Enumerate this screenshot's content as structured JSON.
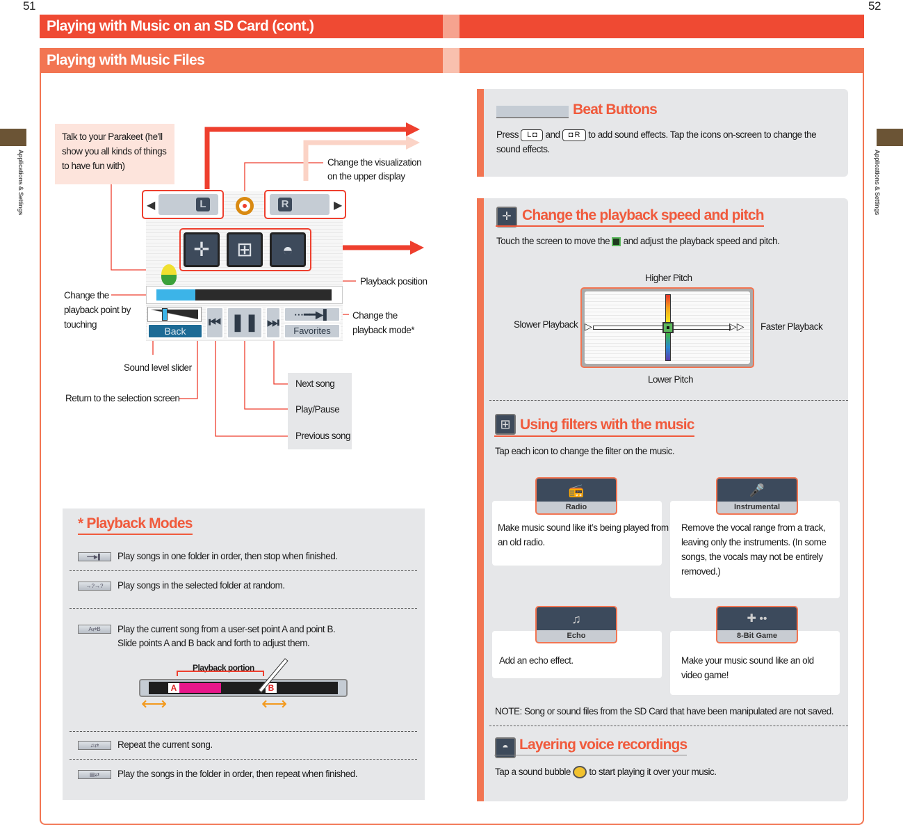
{
  "page_numbers": {
    "left": "51",
    "right": "52"
  },
  "header": {
    "title": "Playing with Music on an SD Card (cont.)",
    "subtitle": "Playing with Music Files"
  },
  "side_tab": {
    "label": "Applications & Settings",
    "color": "#6b5435"
  },
  "colors": {
    "accent": "#ef4a33",
    "accent_light": "#f27552",
    "panel": "#e6e7e9"
  },
  "diagram": {
    "callouts": {
      "parakeet": "Talk to your Parakeet (he'll show you all kinds of things to have fun with)",
      "visualization": "Change the visualization on the upper display",
      "playback_position": "Playback position",
      "playback_point": "Change the playback point by touching",
      "playback_mode": "Change the playback mode*",
      "sound_level": "Sound level slider",
      "return": "Return to the selection screen",
      "next": "Next song",
      "play_pause": "Play/Pause",
      "previous": "Previous song"
    },
    "screen": {
      "back_label": "Back",
      "favorites_label": "Favorites",
      "left_key": "L",
      "right_key": "R",
      "playback_progress": 0.25,
      "volume_level": 0.3
    }
  },
  "playback_modes": {
    "title": "* Playback Modes",
    "items": [
      {
        "icon": "arrow-stop-icon",
        "text": "Play songs in one folder in order, then stop when finished."
      },
      {
        "icon": "random-icon",
        "icon_text": "→?→?",
        "text": "Play songs in the selected folder at random."
      },
      {
        "icon": "ab-repeat-icon",
        "icon_text": "A⇄B",
        "text": "Play the current song from a user-set point A and point B.",
        "text2": "Slide points A and B back and forth to adjust them."
      },
      {
        "icon": "repeat-one-icon",
        "text": "Repeat the current song."
      },
      {
        "icon": "repeat-all-icon",
        "text": "Play the songs in the folder in order, then repeat when finished."
      }
    ],
    "ab_figure": {
      "label": "Playback portion",
      "a": "A",
      "b": "B"
    }
  },
  "beat_buttons": {
    "title": "Beat Buttons",
    "text_press": "Press",
    "key_l": "L ◘",
    "text_and": "and",
    "key_r": "◘ R",
    "text_rest": "to add sound effects. Tap the icons on-screen to change the",
    "text_line2": "sound effects."
  },
  "speed_pitch": {
    "title": "Change the playback speed and pitch",
    "text_a": "Touch the screen to move the",
    "text_b": "and adjust the playback speed and pitch.",
    "higher": "Higher Pitch",
    "lower": "Lower Pitch",
    "slower": "Slower Playback",
    "faster": "Faster Playback"
  },
  "filters": {
    "title": "Using filters with the music",
    "intro": "Tap each icon to change the filter on the music.",
    "items": [
      {
        "label": "Radio",
        "icon": "radio-icon",
        "lines": [
          "Make music sound like it’s being played from",
          "an old radio."
        ]
      },
      {
        "label": "Instrumental",
        "icon": "microphone-icon",
        "lines": [
          "Remove the vocal range from a track,",
          "leaving only the instruments. (In some",
          "songs, the vocals may not be entirely",
          "removed.)"
        ]
      },
      {
        "label": "Echo",
        "icon": "echo-note-icon",
        "lines": [
          "Add an echo effect."
        ]
      },
      {
        "label": "8-Bit Game",
        "icon": "game-controller-icon",
        "lines": [
          "Make your music sound like an old",
          "video game!"
        ]
      }
    ],
    "note": "NOTE: Song or sound files from the SD Card that have been manipulated are not saved."
  },
  "layering": {
    "title": "Layering voice recordings",
    "text_a": "Tap a sound bubble",
    "text_b": "to start playing it over your music."
  }
}
